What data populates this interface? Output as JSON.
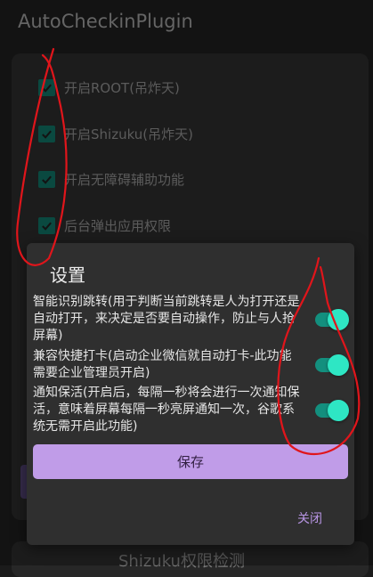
{
  "app": {
    "title": "AutoCheckinPlugin"
  },
  "main": {
    "checkboxes": [
      {
        "label": "开启ROOT(吊炸天)",
        "checked": true
      },
      {
        "label": "开启Shizuku(吊炸天)",
        "checked": true
      },
      {
        "label": "开启无障碍辅助功能",
        "checked": true
      },
      {
        "label": "后台弹出应用权限",
        "checked": true
      }
    ],
    "bottom_card_text": "Shizuku权限检测"
  },
  "dialog": {
    "title": "设置",
    "settings": [
      {
        "text": "智能识别跳转(用于判断当前跳转是人为打开还是自动打开，来决定是否要自动操作，防止与人抢屏幕)",
        "enabled": true
      },
      {
        "text": "兼容快捷打卡(启动企业微信就自动打卡-此功能需要企业管理员开启)",
        "enabled": true
      },
      {
        "text": "通知保活(开启后，每隔一秒将会进行一次通知保活，意味着屏幕每隔一秒亮屏通知一次，谷歌系统无需开启此功能)",
        "enabled": true
      }
    ],
    "save_label": "保存",
    "close_label": "关闭"
  },
  "colors": {
    "accent_teal": "#2ee6c4",
    "button_purple": "#c09ce8",
    "checkbox_teal": "#0e6659",
    "annotation_red": "#e0151b"
  }
}
